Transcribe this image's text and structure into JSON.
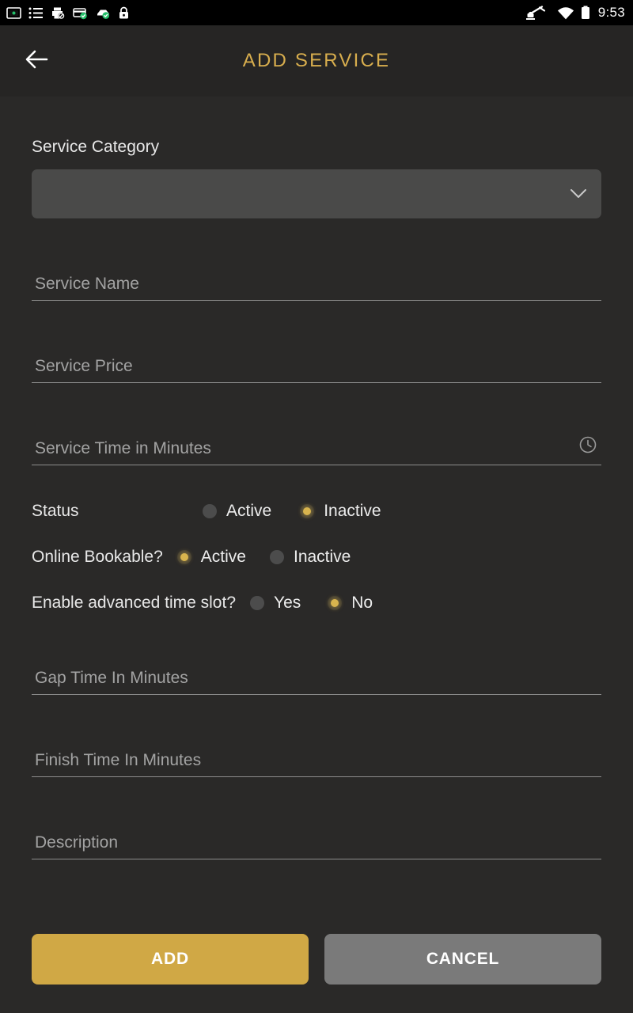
{
  "statusbar": {
    "time": "9:53",
    "left_icons": [
      {
        "name": "screenshot-icon",
        "label": "screenshot"
      },
      {
        "name": "list-icon",
        "label": "list"
      },
      {
        "name": "printer-blocked-icon",
        "label": "printer-disabled"
      },
      {
        "name": "card-check-icon",
        "label": "card-verified"
      },
      {
        "name": "device-check-icon",
        "label": "device-verified"
      },
      {
        "name": "lock-icon",
        "label": "lock"
      }
    ],
    "right_icons": [
      {
        "name": "robot-arm-icon",
        "label": "automation"
      },
      {
        "name": "wifi-icon",
        "label": "wifi"
      },
      {
        "name": "battery-icon",
        "label": "battery"
      }
    ]
  },
  "appbar": {
    "title": "ADD SERVICE",
    "back_label": "Back"
  },
  "form": {
    "category": {
      "label": "Service Category",
      "value": "",
      "placeholder": ""
    },
    "service_name": {
      "placeholder": "Service Name",
      "value": ""
    },
    "service_price": {
      "placeholder": "Service Price",
      "value": ""
    },
    "service_time": {
      "placeholder": "Service Time in Minutes",
      "value": ""
    },
    "status": {
      "label": "Status",
      "options": [
        {
          "label": "Active",
          "selected": false
        },
        {
          "label": "Inactive",
          "selected": true
        }
      ]
    },
    "online_bookable": {
      "label": "Online Bookable?",
      "options": [
        {
          "label": "Active",
          "selected": true
        },
        {
          "label": "Inactive",
          "selected": false
        }
      ]
    },
    "advanced_time_slot": {
      "label": "Enable advanced time slot?",
      "options": [
        {
          "label": "Yes",
          "selected": false
        },
        {
          "label": "No",
          "selected": true
        }
      ]
    },
    "gap_time": {
      "placeholder": "Gap Time In Minutes",
      "value": ""
    },
    "finish_time": {
      "placeholder": "Finish Time In Minutes",
      "value": ""
    },
    "description": {
      "placeholder": "Description",
      "value": ""
    }
  },
  "actions": {
    "add_label": "ADD",
    "cancel_label": "CANCEL"
  },
  "colors": {
    "accent_gold": "#d0a845",
    "title_gold": "#d8ae4e",
    "background": "#2a2928",
    "appbar": "#262524",
    "select_fill": "#4a4a49",
    "cancel_gray": "#7a7a7a"
  }
}
